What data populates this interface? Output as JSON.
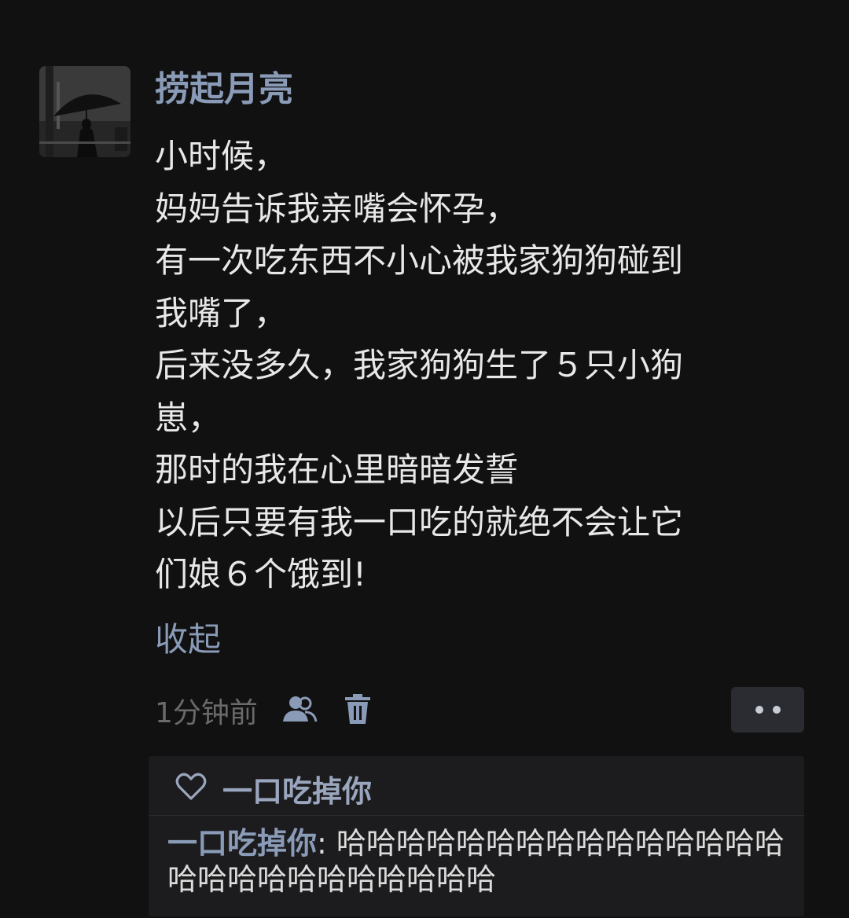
{
  "post": {
    "author": "捞起月亮",
    "lines": [
      "小时候，",
      "妈妈告诉我亲嘴会怀孕，",
      "有一次吃东西不小心被我家狗狗碰到",
      "我嘴了，",
      "后来没多久，我家狗狗生了５只小狗",
      "崽，",
      "那时的我在心里暗暗发誓",
      "以后只要有我一口吃的就绝不会让它",
      "们娘６个饿到!"
    ],
    "collapse_label": "收起",
    "time": "1分钟前"
  },
  "icons": {
    "avatar": "avatar-umbrella-photo",
    "visibility": "friends-icon",
    "delete": "trash-icon",
    "more": "more-dots-icon",
    "like": "heart-outline-icon"
  },
  "reply": {
    "likes": {
      "user": "一口吃掉你"
    },
    "comment": {
      "author": "一口吃掉你",
      "separator": ": ",
      "text": "哈哈哈哈哈哈哈哈哈哈哈哈哈哈哈哈哈哈哈哈哈哈哈哈哈哈"
    }
  },
  "colors": {
    "background": "#111111",
    "name_link": "#8a9bb8",
    "text": "#e8e8e8",
    "muted": "#6a6a6a"
  }
}
